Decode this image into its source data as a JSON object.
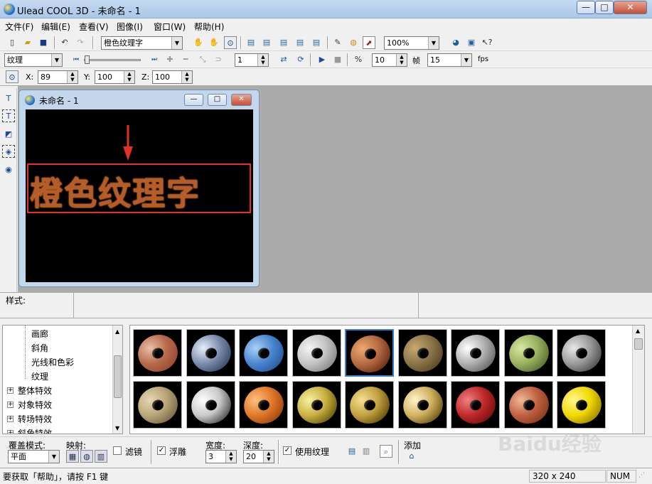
{
  "app": {
    "title": "Ulead COOL 3D - 未命名 - 1"
  },
  "window_buttons": {
    "minimize": "—",
    "maximize": "□",
    "close": "✕"
  },
  "menu": [
    "文件(F)",
    "编辑(E)",
    "查看(V)",
    "图像(I)",
    "窗口(W)",
    "帮助(H)"
  ],
  "toolbar1": {
    "object_combo": "橙色纹理字",
    "zoom": "100%"
  },
  "toolbar2": {
    "attr_combo": "纹理",
    "frame_value": "1",
    "frames_total": "10",
    "frame_label": "帧",
    "fps_value": "15",
    "fps_label": "fps"
  },
  "toolbar3": {
    "x_label": "X:",
    "x_value": "89",
    "y_label": "Y:",
    "y_value": "100",
    "z_label": "Z:",
    "z_value": "100"
  },
  "document": {
    "title": "未命名 - 1",
    "text": "橙色纹理字"
  },
  "style_bar": {
    "label": "样式:"
  },
  "tree": {
    "items": [
      "画廊",
      "斜角",
      "光线和色彩",
      "纹理",
      "整体特效",
      "对象特效",
      "转场特效",
      "斜角特效"
    ]
  },
  "gallery": {
    "thumbs": [
      {
        "c1": "#9a4c34",
        "c2": "#e8c0a8",
        "mid": "#b86a4c"
      },
      {
        "c1": "#3a4a6a",
        "c2": "#e8eefa",
        "mid": "#7a8cae"
      },
      {
        "c1": "#2a5aa0",
        "c2": "#a8d0f8",
        "mid": "#4a86d0"
      },
      {
        "c1": "#8a8a8a",
        "c2": "#f4f4f4",
        "mid": "#c4c4c4"
      },
      {
        "c1": "#6a3218",
        "c2": "#f0a870",
        "mid": "#b46a40"
      },
      {
        "c1": "#5a4828",
        "c2": "#c8a870",
        "mid": "#8a7448"
      },
      {
        "c1": "#6a6a6a",
        "c2": "#ffffff",
        "mid": "#b0b0b0"
      },
      {
        "c1": "#5a7030",
        "c2": "#d8e8a0",
        "mid": "#98b060"
      },
      {
        "c1": "#505050",
        "c2": "#e8e8e8",
        "mid": "#9a9a9a"
      },
      {
        "c1": "#7a6a48",
        "c2": "#e8d8b0",
        "mid": "#b8a478"
      },
      {
        "c1": "#505050",
        "c2": "#ffffff",
        "mid": "#c8c8c8"
      },
      {
        "c1": "#a04810",
        "c2": "#ffc080",
        "mid": "#e07828"
      },
      {
        "c1": "#6a5a10",
        "c2": "#f8f0a0",
        "mid": "#c8b040"
      },
      {
        "c1": "#6a5010",
        "c2": "#f8e090",
        "mid": "#c0a040"
      },
      {
        "c1": "#705818",
        "c2": "#fff4c8",
        "mid": "#d0b060"
      },
      {
        "c1": "#7a1010",
        "c2": "#f08080",
        "mid": "#c02828"
      },
      {
        "c1": "#8a3c20",
        "c2": "#f0b898",
        "mid": "#c06040"
      },
      {
        "c1": "#a08a00",
        "c2": "#fff890",
        "mid": "#f0d800"
      }
    ],
    "selected_index": 4
  },
  "bottom": {
    "blend_label": "覆盖模式:",
    "blend_value": "平面",
    "map_label": "映射:",
    "filter_label": "滤镜",
    "emboss_label": "浮雕",
    "width_label": "宽度:",
    "width_value": "3",
    "depth_label": "深度:",
    "depth_value": "20",
    "use_texture_label": "使用纹理",
    "add_label": "添加"
  },
  "status": {
    "message": "要获取「帮助」，请按 F1 键",
    "size": "320 x 240",
    "num": "NUM"
  },
  "watermark": {
    "text": "Baidu经验"
  }
}
